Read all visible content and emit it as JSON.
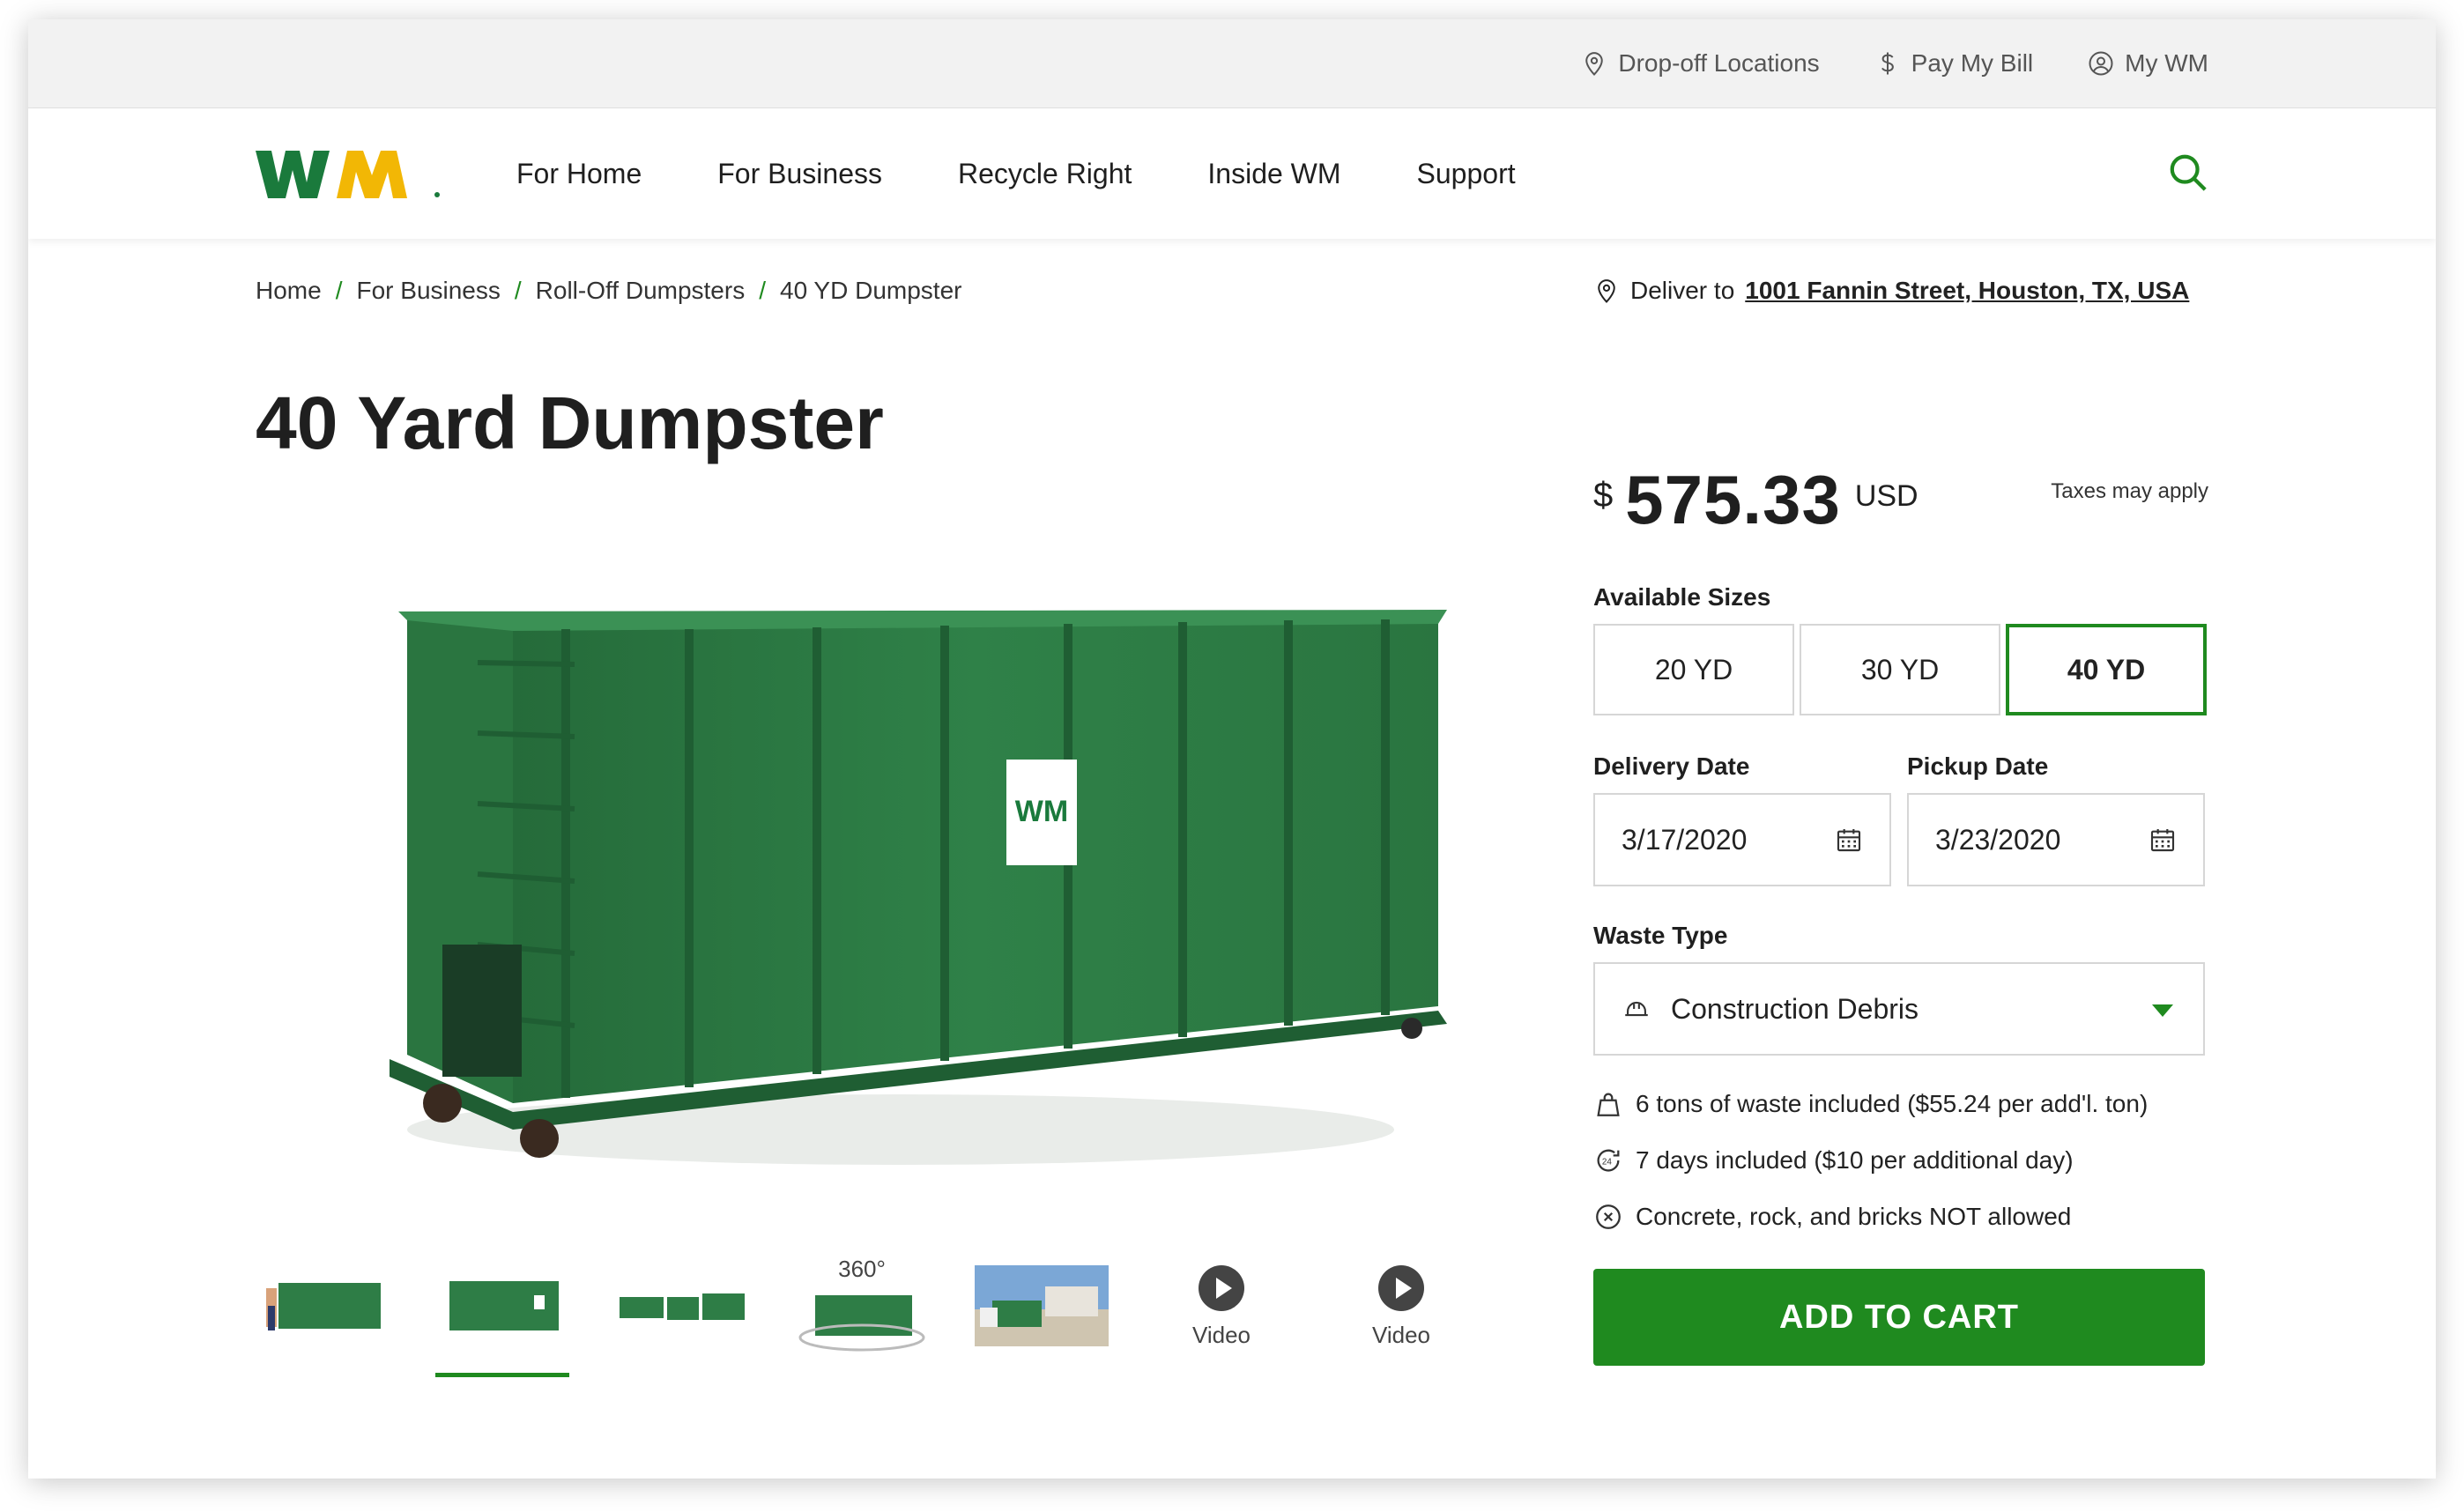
{
  "utility": {
    "links": [
      {
        "label": "Drop-off Locations",
        "icon": "location-pin-icon"
      },
      {
        "label": "Pay My Bill",
        "icon": "dollar-icon"
      },
      {
        "label": "My WM",
        "icon": "user-circle-icon"
      }
    ]
  },
  "nav": {
    "logo_text": "WM",
    "items": [
      "For Home",
      "For Business",
      "Recycle Right",
      "Inside WM",
      "Support"
    ]
  },
  "breadcrumb": [
    "Home",
    "For Business",
    "Roll-Off Dumpsters",
    "40 YD Dumpster"
  ],
  "delivery": {
    "prefix": "Deliver to",
    "address": "1001 Fannin Street, Houston, TX, USA"
  },
  "product": {
    "title": "40 Yard Dumpster",
    "currency_symbol": "$",
    "price": "575.33",
    "currency": "USD",
    "taxes_note": "Taxes may apply"
  },
  "sizes": {
    "label": "Available Sizes",
    "options": [
      "20 YD",
      "30 YD",
      "40 YD"
    ],
    "selected": "40 YD"
  },
  "dates": {
    "delivery_label": "Delivery Date",
    "delivery_value": "3/17/2020",
    "pickup_label": "Pickup Date",
    "pickup_value": "3/23/2020"
  },
  "waste": {
    "label": "Waste Type",
    "value": "Construction Debris"
  },
  "features": [
    "6 tons of waste included ($55.24 per add'l. ton)",
    "7 days included ($10 per additional day)",
    "Concrete, rock, and bricks NOT allowed"
  ],
  "thumbnails": {
    "spin_label": "360°",
    "video_label": "Video"
  },
  "cta": {
    "label": "ADD TO CART"
  },
  "colors": {
    "brand_green": "#1f8a1f",
    "logo_green": "#1a7a3c",
    "logo_yellow": "#f2b705",
    "dumpster_green": "#2e7d46"
  }
}
